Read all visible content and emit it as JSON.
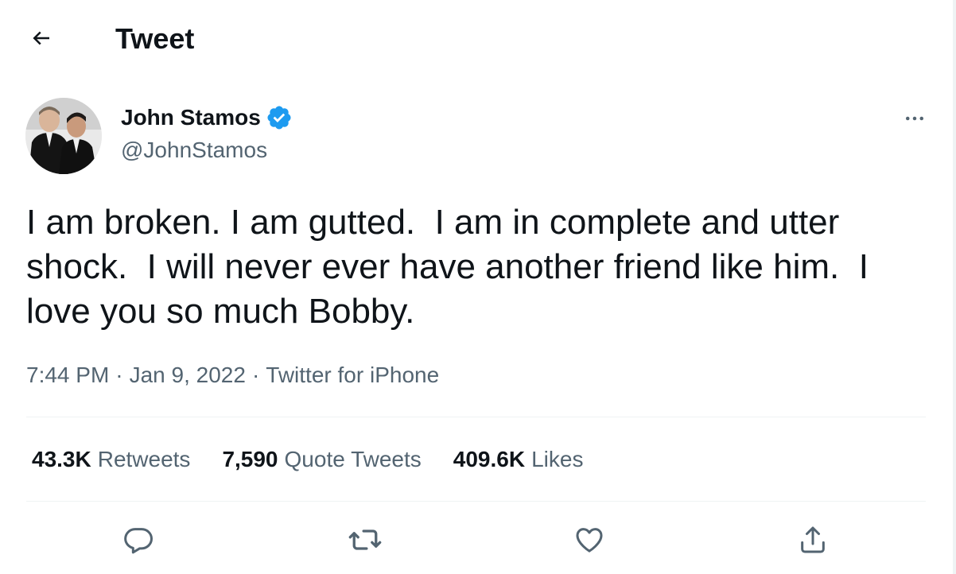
{
  "header": {
    "title": "Tweet",
    "back_icon": "arrow-left-icon"
  },
  "author": {
    "display_name": "John Stamos",
    "handle": "@JohnStamos",
    "verified": true,
    "verified_color": "#1d9bf0"
  },
  "tweet": {
    "text": "I am broken. I am gutted.  I am in complete and utter shock.  I will never ever have another friend like him.  I love you so much Bobby.",
    "time": "7:44 PM",
    "date": "Jan 9, 2022",
    "source": "Twitter for iPhone"
  },
  "stats": {
    "retweets_count": "43.3K",
    "retweets_label": "Retweets",
    "quotes_count": "7,590",
    "quotes_label": "Quote Tweets",
    "likes_count": "409.6K",
    "likes_label": "Likes"
  },
  "actions": {
    "icons": [
      "reply-icon",
      "retweet-icon",
      "like-icon",
      "share-icon"
    ]
  },
  "colors": {
    "text_primary": "#0f1419",
    "text_secondary": "#536471",
    "divider": "#eff3f4",
    "accent": "#1d9bf0"
  }
}
